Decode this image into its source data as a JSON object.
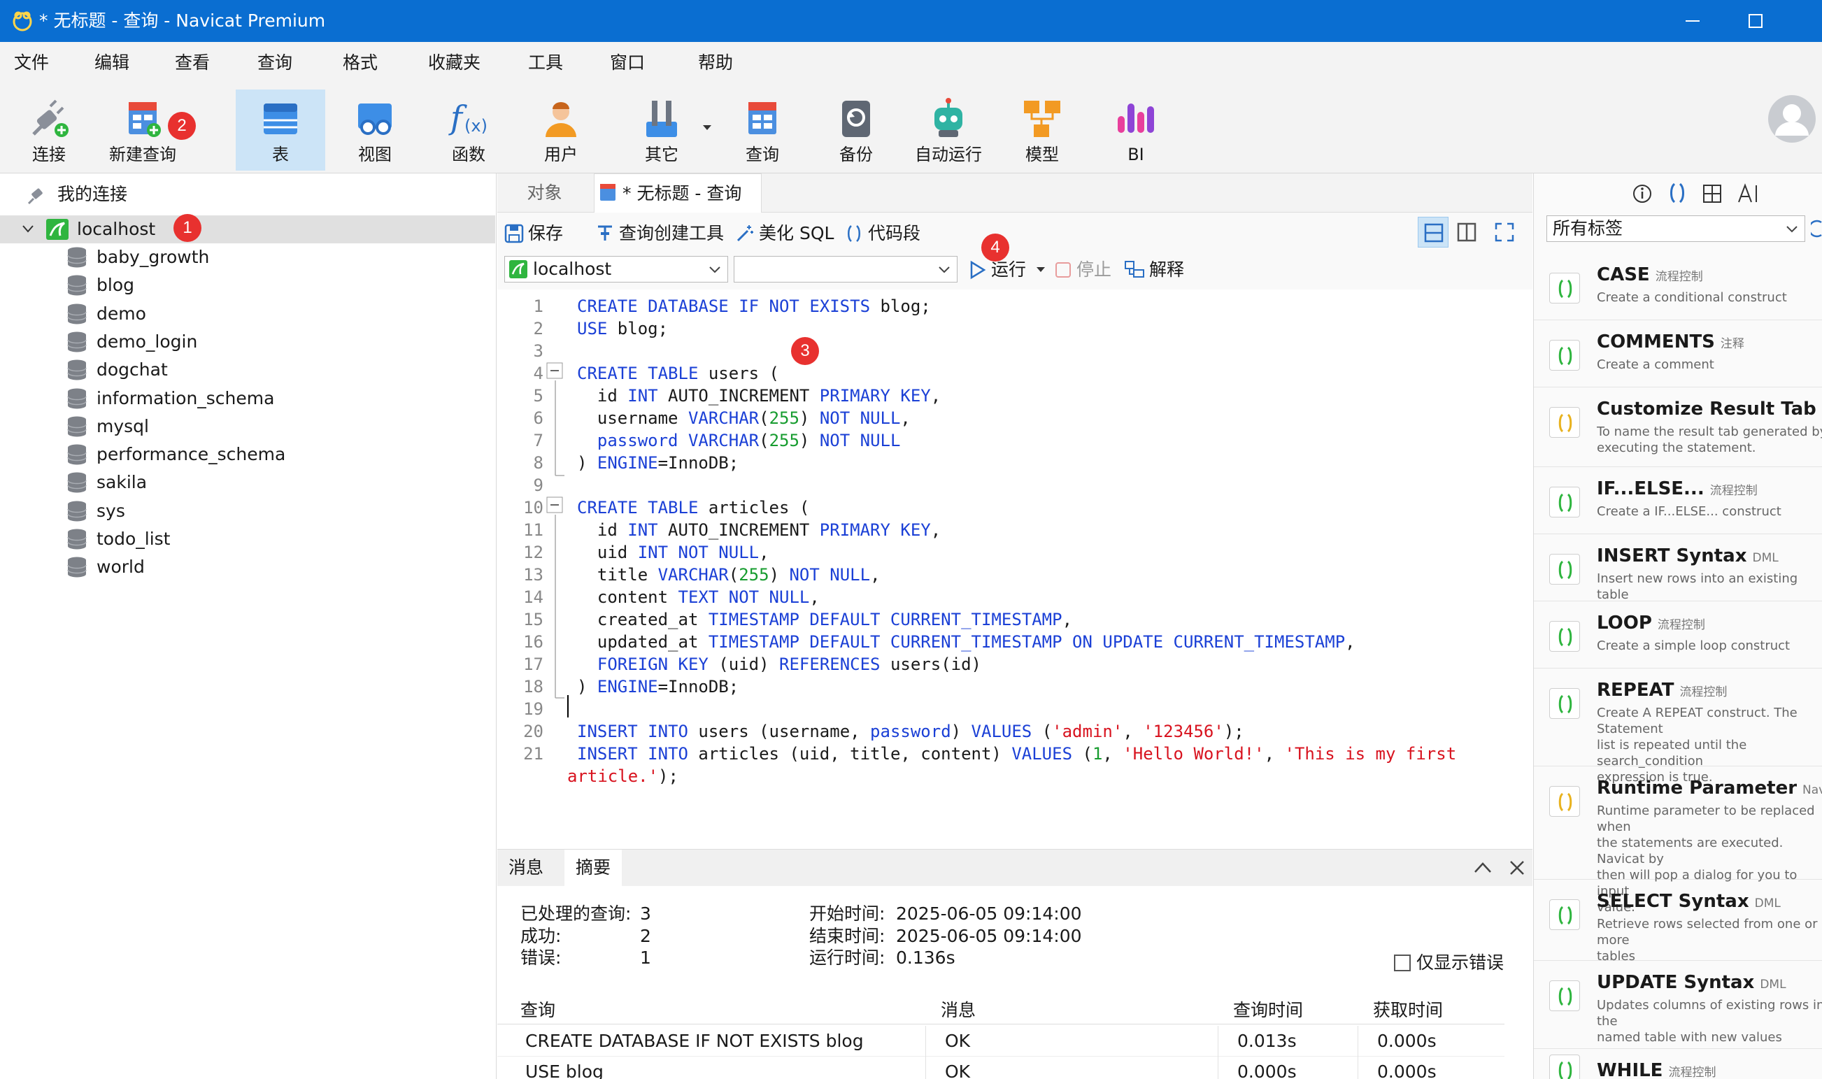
{
  "window": {
    "title": "* 无标题 - 查询 - Navicat Premium"
  },
  "menu": [
    "文件",
    "编辑",
    "查看",
    "查询",
    "格式",
    "收藏夹",
    "工具",
    "窗口",
    "帮助"
  ],
  "ribbon": {
    "connect": "连接",
    "new_query": "新建查询",
    "table": "表",
    "view": "视图",
    "function": "函数",
    "user": "用户",
    "other": "其它",
    "query": "查询",
    "backup": "备份",
    "auto_run": "自动运行",
    "model": "模型",
    "bi": "BI"
  },
  "badges": [
    "1",
    "2",
    "3",
    "4"
  ],
  "tree": {
    "root": "我的连接",
    "connection": "localhost",
    "databases": [
      "baby_growth",
      "blog",
      "demo",
      "demo_login",
      "dogchat",
      "information_schema",
      "mysql",
      "performance_schema",
      "sakila",
      "sys",
      "todo_list",
      "world"
    ]
  },
  "tabs": {
    "objects": "对象",
    "query_tab": "* 无标题 - 查询"
  },
  "query_toolbar": {
    "save": "保存",
    "builder": "查询创建工具",
    "beautify": "美化 SQL",
    "snippet": "代码段",
    "connection_value": "localhost",
    "database_value": "",
    "run": "运行",
    "stop": "停止",
    "explain": "解释"
  },
  "sql_lines": [
    "1",
    "2",
    "3",
    "4",
    "5",
    "6",
    "7",
    "8",
    "9",
    "10",
    "11",
    "12",
    "13",
    "14",
    "15",
    "16",
    "17",
    "18",
    "19",
    "20",
    "21"
  ],
  "sql": {
    "l1": [
      "CREATE DATABASE IF NOT EXISTS",
      " blog;"
    ],
    "l2": [
      "USE",
      " blog;"
    ],
    "l4": [
      "CREATE TABLE",
      " users ("
    ],
    "l5": [
      "  id ",
      "INT",
      " AUTO_INCREMENT ",
      "PRIMARY KEY",
      ","
    ],
    "l6": [
      "  username ",
      "VARCHAR",
      "(",
      "255",
      ") ",
      "NOT NULL",
      ","
    ],
    "l7": [
      "  ",
      "password",
      " ",
      "VARCHAR",
      "(",
      "255",
      ") ",
      "NOT NULL"
    ],
    "l8": [
      ") ",
      "ENGINE",
      "=InnoDB;"
    ],
    "l10": [
      "CREATE TABLE",
      " articles ("
    ],
    "l11": [
      "  id ",
      "INT",
      " AUTO_INCREMENT ",
      "PRIMARY KEY",
      ","
    ],
    "l12": [
      "  uid ",
      "INT NOT NULL",
      ","
    ],
    "l13": [
      "  title ",
      "VARCHAR",
      "(",
      "255",
      ") ",
      "NOT NULL",
      ","
    ],
    "l14": [
      "  content ",
      "TEXT NOT NULL",
      ","
    ],
    "l15": [
      "  created_at ",
      "TIMESTAMP DEFAULT CURRENT_TIMESTAMP",
      ","
    ],
    "l16": [
      "  updated_at ",
      "TIMESTAMP DEFAULT CURRENT_TIMESTAMP ON UPDATE CURRENT_TIMESTAMP",
      ","
    ],
    "l17": [
      "  ",
      "FOREIGN KEY",
      " (uid) ",
      "REFERENCES",
      " users(id)"
    ],
    "l18": [
      ") ",
      "ENGINE",
      "=InnoDB;"
    ],
    "l20": [
      "INSERT INTO",
      " users (username, ",
      "password",
      ") ",
      "VALUES",
      " (",
      "'admin'",
      ", ",
      "'123456'",
      ");"
    ],
    "l21": [
      "INSERT INTO",
      " articles (uid, title, content) ",
      "VALUES",
      " (",
      "1",
      ", ",
      "'Hello World!'",
      ", ",
      "'This is my first"
    ],
    "l21b": [
      "article.'",
      ");"
    ]
  },
  "bottom": {
    "tab_messages": "消息",
    "tab_summary": "摘要",
    "processed_label": "已处理的查询:",
    "processed_value": "3",
    "success_label": "成功:",
    "success_value": "2",
    "error_label": "错误:",
    "error_value": "1",
    "start_label": "开始时间:",
    "start_value": "2025-06-05 09:14:00",
    "end_label": "结束时间:",
    "end_value": "2025-06-05 09:14:00",
    "elapsed_label": "运行时间:",
    "elapsed_value": "0.136s",
    "only_errors": "仅显示错误",
    "columns": [
      "查询",
      "消息",
      "查询时间",
      "获取时间"
    ],
    "rows": [
      [
        "CREATE DATABASE IF NOT EXISTS blog",
        "OK",
        "0.013s",
        "0.000s"
      ],
      [
        "USE blog",
        "OK",
        "0.000s",
        "0.000s"
      ]
    ]
  },
  "right_panel": {
    "tag_filter": "所有标签",
    "snippets": [
      {
        "title": "CASE",
        "tag": "流程控制",
        "desc": "Create a conditional construct"
      },
      {
        "title": "COMMENTS",
        "tag": "注释",
        "desc": "Create a comment"
      },
      {
        "title": "Customize Result Tab Name",
        "tag": "",
        "desc": "To name the result tab generated by\nexecuting the statement."
      },
      {
        "title": "IF...ELSE...",
        "tag": "流程控制",
        "desc": "Create a IF...ELSE... construct"
      },
      {
        "title": "INSERT Syntax",
        "tag": "DML",
        "desc": "Insert new rows into an existing table"
      },
      {
        "title": "LOOP",
        "tag": "流程控制",
        "desc": "Create a simple loop construct"
      },
      {
        "title": "REPEAT",
        "tag": "流程控制",
        "desc": "Create A REPEAT construct. The Statement\nlist is repeated until the search_condition\nexpression is true."
      },
      {
        "title": "Runtime Parameter",
        "tag": "Navicat-only",
        "desc": "Runtime parameter to be replaced when\nthe statements are executed. Navicat by\nthen will pop a dialog for you to input\nvalue."
      },
      {
        "title": "SELECT Syntax",
        "tag": "DML",
        "desc": "Retrieve rows selected from one or more\ntables"
      },
      {
        "title": "UPDATE Syntax",
        "tag": "DML",
        "desc": "Updates columns of existing rows in the\nnamed table with new values"
      },
      {
        "title": "WHILE",
        "tag": "流程控制",
        "desc": ""
      }
    ]
  },
  "colors": {
    "titlebar": "#0a6ed1",
    "keyword": "#1b40d6",
    "number": "#179c2f",
    "string": "#d8131f",
    "badge": "#e8312f"
  }
}
